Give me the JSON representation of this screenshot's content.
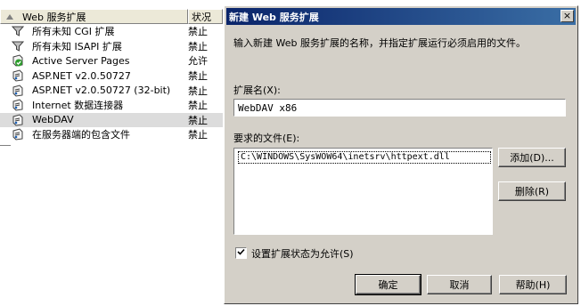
{
  "list": {
    "header": {
      "name": "Web 服务扩展",
      "status": "状况"
    },
    "rows": [
      {
        "label": "所有未知 CGI 扩展",
        "status": "禁止",
        "icon": "filter-icon"
      },
      {
        "label": "所有未知 ISAPI 扩展",
        "status": "禁止",
        "icon": "filter-icon"
      },
      {
        "label": "Active Server Pages",
        "status": "允许",
        "icon": "allowed-extension-icon"
      },
      {
        "label": "ASP.NET v2.0.50727",
        "status": "禁止",
        "icon": "extension-icon"
      },
      {
        "label": "ASP.NET v2.0.50727 (32-bit)",
        "status": "禁止",
        "icon": "extension-icon"
      },
      {
        "label": "Internet 数据连接器",
        "status": "禁止",
        "icon": "extension-icon"
      },
      {
        "label": "WebDAV",
        "status": "禁止",
        "icon": "extension-icon",
        "selected": true
      },
      {
        "label": "在服务器端的包含文件",
        "status": "禁止",
        "icon": "extension-icon"
      }
    ]
  },
  "dialog": {
    "title": "新建 Web 服务扩展",
    "close": "×",
    "intro": "输入新建 Web 服务扩展的名称，并指定扩展运行必须启用的文件。",
    "name_label": "扩展名(X):",
    "name_value": "WebDAV x86",
    "files_label": "要求的文件(E):",
    "files": [
      "C:\\WINDOWS\\SysWOW64\\inetsrv\\httpext.dll"
    ],
    "add_button": "添加(D)...",
    "remove_button": "删除(R)",
    "checkbox_label": "设置扩展状态为允许(S)",
    "checkbox_checked": true,
    "ok_button": "确定",
    "cancel_button": "取消",
    "help_button": "帮助(H)"
  }
}
